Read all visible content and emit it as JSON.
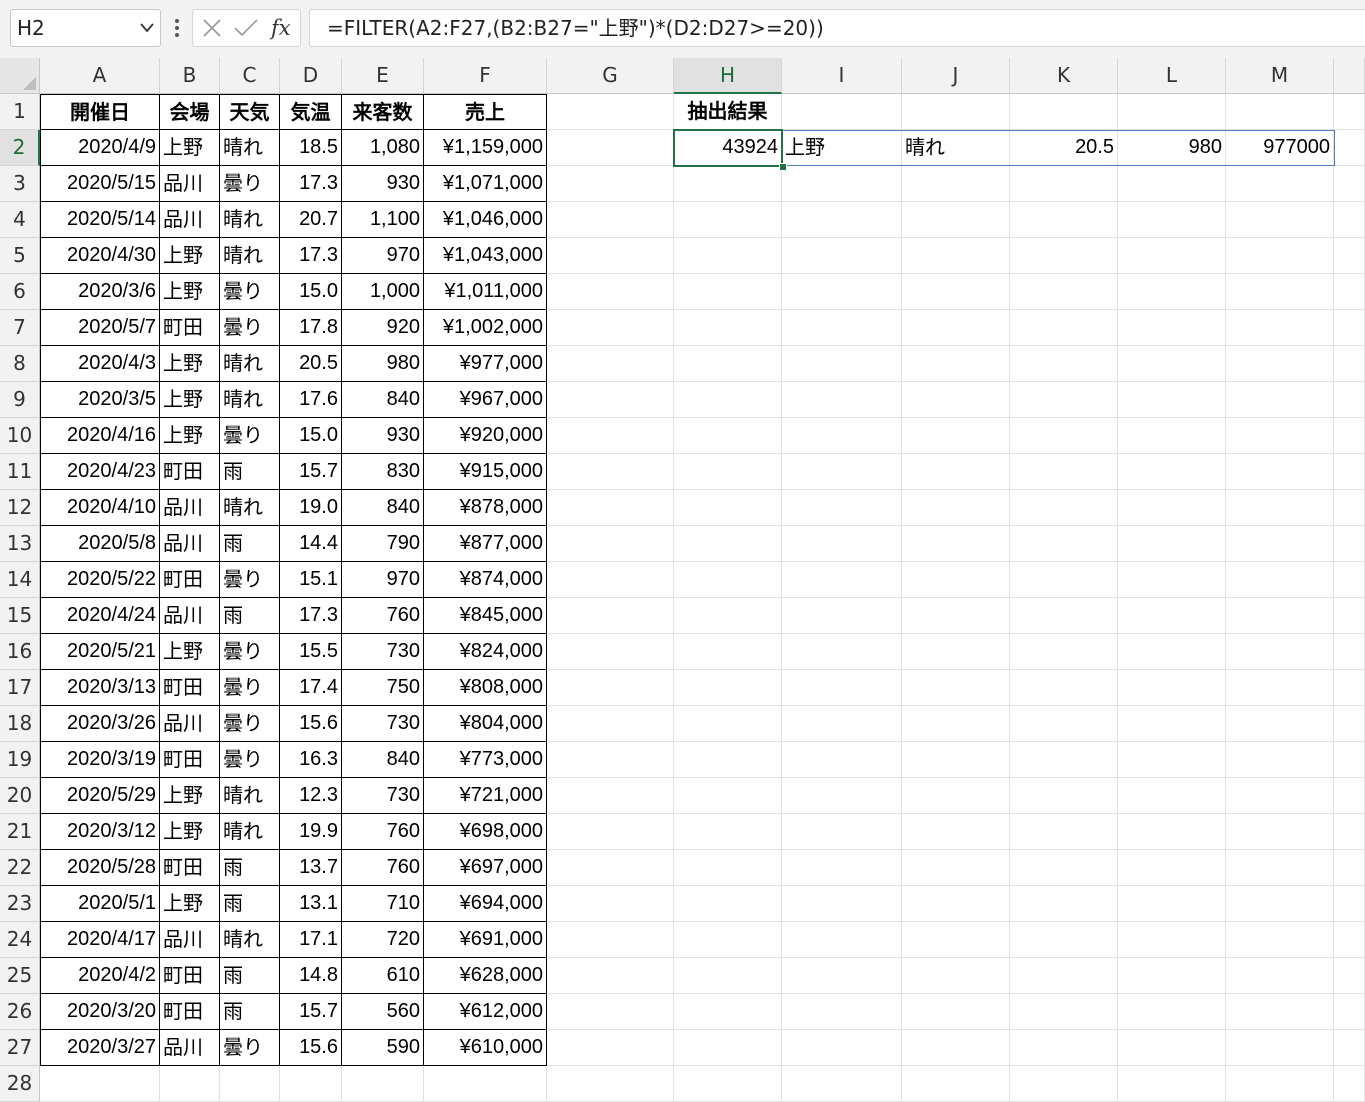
{
  "formula_bar": {
    "name_box": "H2",
    "formula": "=FILTER(A2:F27,(B2:B27=\"上野\")*(D2:D27>=20))",
    "fx_label": "fx"
  },
  "columns": [
    "A",
    "B",
    "C",
    "D",
    "E",
    "F",
    "G",
    "H",
    "I",
    "J",
    "K",
    "L",
    "M"
  ],
  "row_numbers": [
    "1",
    "2",
    "3",
    "4",
    "5",
    "6",
    "7",
    "8",
    "9",
    "10",
    "11",
    "12",
    "13",
    "14",
    "15",
    "16",
    "17",
    "18",
    "19",
    "20",
    "21",
    "22",
    "23",
    "24",
    "25",
    "26",
    "27",
    "28"
  ],
  "table": {
    "headers": [
      "開催日",
      "会場",
      "天気",
      "気温",
      "来客数",
      "売上"
    ],
    "rows": [
      [
        "2020/4/9",
        "上野",
        "晴れ",
        "18.5",
        "1,080",
        "¥1,159,000"
      ],
      [
        "2020/5/15",
        "品川",
        "曇り",
        "17.3",
        "930",
        "¥1,071,000"
      ],
      [
        "2020/5/14",
        "品川",
        "晴れ",
        "20.7",
        "1,100",
        "¥1,046,000"
      ],
      [
        "2020/4/30",
        "上野",
        "晴れ",
        "17.3",
        "970",
        "¥1,043,000"
      ],
      [
        "2020/3/6",
        "上野",
        "曇り",
        "15.0",
        "1,000",
        "¥1,011,000"
      ],
      [
        "2020/5/7",
        "町田",
        "曇り",
        "17.8",
        "920",
        "¥1,002,000"
      ],
      [
        "2020/4/3",
        "上野",
        "晴れ",
        "20.5",
        "980",
        "¥977,000"
      ],
      [
        "2020/3/5",
        "上野",
        "晴れ",
        "17.6",
        "840",
        "¥967,000"
      ],
      [
        "2020/4/16",
        "上野",
        "曇り",
        "15.0",
        "930",
        "¥920,000"
      ],
      [
        "2020/4/23",
        "町田",
        "雨",
        "15.7",
        "830",
        "¥915,000"
      ],
      [
        "2020/4/10",
        "品川",
        "晴れ",
        "19.0",
        "840",
        "¥878,000"
      ],
      [
        "2020/5/8",
        "品川",
        "雨",
        "14.4",
        "790",
        "¥877,000"
      ],
      [
        "2020/5/22",
        "町田",
        "曇り",
        "15.1",
        "970",
        "¥874,000"
      ],
      [
        "2020/4/24",
        "品川",
        "雨",
        "17.3",
        "760",
        "¥845,000"
      ],
      [
        "2020/5/21",
        "上野",
        "曇り",
        "15.5",
        "730",
        "¥824,000"
      ],
      [
        "2020/3/13",
        "町田",
        "曇り",
        "17.4",
        "750",
        "¥808,000"
      ],
      [
        "2020/3/26",
        "品川",
        "曇り",
        "15.6",
        "730",
        "¥804,000"
      ],
      [
        "2020/3/19",
        "町田",
        "曇り",
        "16.3",
        "840",
        "¥773,000"
      ],
      [
        "2020/5/29",
        "上野",
        "晴れ",
        "12.3",
        "730",
        "¥721,000"
      ],
      [
        "2020/3/12",
        "上野",
        "晴れ",
        "19.9",
        "760",
        "¥698,000"
      ],
      [
        "2020/5/28",
        "町田",
        "雨",
        "13.7",
        "760",
        "¥697,000"
      ],
      [
        "2020/5/1",
        "上野",
        "雨",
        "13.1",
        "710",
        "¥694,000"
      ],
      [
        "2020/4/17",
        "品川",
        "晴れ",
        "17.1",
        "720",
        "¥691,000"
      ],
      [
        "2020/4/2",
        "町田",
        "雨",
        "14.8",
        "610",
        "¥628,000"
      ],
      [
        "2020/3/20",
        "町田",
        "雨",
        "15.7",
        "560",
        "¥612,000"
      ],
      [
        "2020/3/27",
        "品川",
        "曇り",
        "15.6",
        "590",
        "¥610,000"
      ]
    ]
  },
  "result": {
    "title": "抽出結果",
    "row": [
      "43924",
      "上野",
      "晴れ",
      "20.5",
      "980",
      "977000"
    ]
  },
  "active_column": "H",
  "active_row": "2",
  "colors": {
    "accent": "#217346",
    "spill_border": "#4a7fc1"
  },
  "icons": {
    "cancel": "x-icon",
    "enter": "check-icon",
    "menu": "vertical-dots-icon",
    "dropdown": "chevron-down-icon"
  }
}
